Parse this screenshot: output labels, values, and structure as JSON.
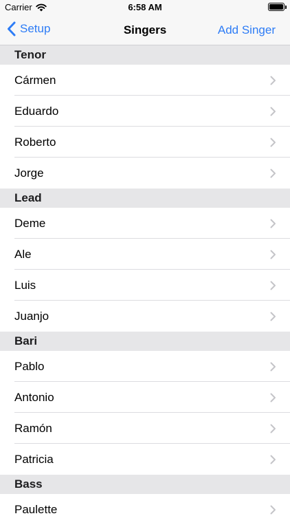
{
  "status_bar": {
    "carrier": "Carrier",
    "time": "6:58 AM"
  },
  "nav": {
    "back_label": "Setup",
    "title": "Singers",
    "add_label": "Add Singer"
  },
  "sections": [
    {
      "title": "Tenor",
      "singers": [
        "Cármen",
        "Eduardo",
        "Roberto",
        "Jorge"
      ]
    },
    {
      "title": "Lead",
      "singers": [
        "Deme",
        "Ale",
        "Luis",
        "Juanjo"
      ]
    },
    {
      "title": "Bari",
      "singers": [
        "Pablo",
        "Antonio",
        "Ramón",
        "Patricia"
      ]
    },
    {
      "title": "Bass",
      "singers": [
        "Paulette"
      ]
    }
  ],
  "colors": {
    "accent": "#2d7cf6",
    "section_header_bg": "#e6e6e8",
    "nav_bg": "#f7f7f7"
  },
  "icons": {
    "back": "chevron-left-icon",
    "row": "chevron-right-icon",
    "wifi": "wifi-icon",
    "battery": "battery-icon"
  }
}
